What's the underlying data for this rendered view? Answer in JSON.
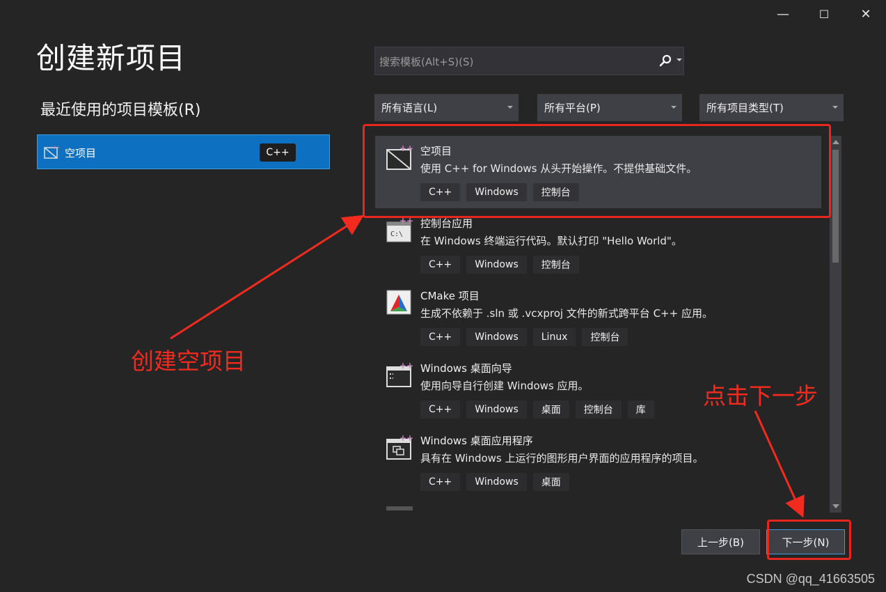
{
  "window": {
    "minimize_glyph": "—",
    "maximize_glyph": "☐",
    "close_glyph": "✕"
  },
  "title": "创建新项目",
  "recent": {
    "heading": "最近使用的项目模板(R)",
    "items": [
      {
        "label": "空项目",
        "badge": "C++",
        "icon": "empty-project-icon"
      }
    ]
  },
  "search": {
    "placeholder": "搜索模板(Alt+S)(S)",
    "icon": "search-icon"
  },
  "filters": {
    "language": "所有语言(L)",
    "platform": "所有平台(P)",
    "project_type": "所有项目类型(T)"
  },
  "templates": [
    {
      "name": "空项目",
      "description": "使用 C++ for Windows 从头开始操作。不提供基础文件。",
      "tags": [
        "C++",
        "Windows",
        "控制台"
      ],
      "icon": "empty-project-icon",
      "selected": true
    },
    {
      "name": "控制台应用",
      "description": "在 Windows 终端运行代码。默认打印 \"Hello World\"。",
      "tags": [
        "C++",
        "Windows",
        "控制台"
      ],
      "icon": "console-app-icon",
      "selected": false
    },
    {
      "name": "CMake 项目",
      "description": "生成不依赖于 .sln 或 .vcxproj 文件的新式跨平台 C++ 应用。",
      "tags": [
        "C++",
        "Windows",
        "Linux",
        "控制台"
      ],
      "icon": "cmake-icon",
      "selected": false
    },
    {
      "name": "Windows 桌面向导",
      "description": "使用向导自行创建 Windows 应用。",
      "tags": [
        "C++",
        "Windows",
        "桌面",
        "控制台",
        "库"
      ],
      "icon": "wizard-icon",
      "selected": false
    },
    {
      "name": "Windows 桌面应用程序",
      "description": "具有在 Windows 上运行的图形用户界面的应用程序的项目。",
      "tags": [
        "C++",
        "Windows",
        "桌面"
      ],
      "icon": "desktop-app-icon",
      "selected": false
    }
  ],
  "buttons": {
    "back": "上一步(B)",
    "next": "下一步(N)"
  },
  "annotations": {
    "create_empty": "创建空项目",
    "click_next": "点击下一步"
  },
  "watermark": "CSDN @qq_41663505",
  "colors": {
    "accent": "#0e70c0",
    "annotation_red": "#e8281e",
    "background": "#252526"
  }
}
